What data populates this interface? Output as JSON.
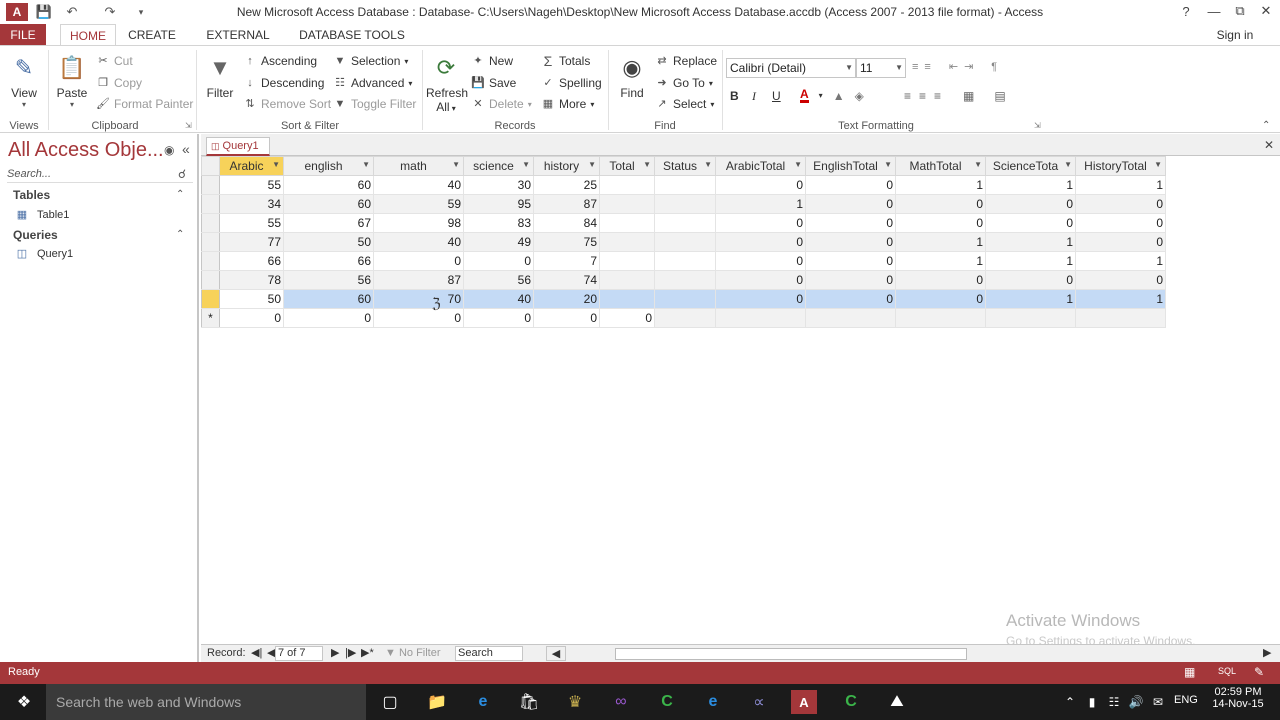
{
  "window": {
    "title": "New Microsoft Access Database : Database- C:\\Users\\Nageh\\Desktop\\New Microsoft Access Database.accdb (Access 2007 - 2013 file format) - Access",
    "help": "?",
    "sign_in": "Sign in"
  },
  "tabs": [
    "FILE",
    "HOME",
    "CREATE",
    "EXTERNAL DATA",
    "DATABASE TOOLS"
  ],
  "ribbon": {
    "views": {
      "view": "View",
      "group": "Views"
    },
    "clipboard": {
      "paste": "Paste",
      "cut": "Cut",
      "copy": "Copy",
      "format_painter": "Format Painter",
      "group": "Clipboard"
    },
    "sort_filter": {
      "filter": "Filter",
      "ascending": "Ascending",
      "descending": "Descending",
      "remove_sort": "Remove Sort",
      "selection": "Selection",
      "advanced": "Advanced",
      "toggle_filter": "Toggle Filter",
      "group": "Sort & Filter"
    },
    "records": {
      "refresh": "Refresh",
      "refresh_all": "All",
      "new": "New",
      "save": "Save",
      "delete": "Delete",
      "totals": "Totals",
      "spelling": "Spelling",
      "more": "More",
      "group": "Records"
    },
    "find": {
      "find": "Find",
      "replace": "Replace",
      "goto": "Go To",
      "select": "Select",
      "group": "Find"
    },
    "text_formatting": {
      "font": "Calibri (Detail)",
      "size": "11",
      "bold": "B",
      "italic": "I",
      "underline": "U",
      "group": "Text Formatting"
    }
  },
  "nav": {
    "header": "All Access Obje...",
    "search_placeholder": "Search...",
    "sections": [
      {
        "title": "Tables",
        "items": [
          "Table1"
        ]
      },
      {
        "title": "Queries",
        "items": [
          "Query1"
        ]
      }
    ]
  },
  "doc_tab": "Query1",
  "grid": {
    "columns": [
      "Arabic",
      "english",
      "math",
      "science",
      "history",
      "Total",
      "Status",
      "ArabicTotal",
      "EnglishTotal",
      "MathTotal",
      "ScienceTota",
      "HistoryTotal"
    ],
    "rows": [
      [
        "55",
        "60",
        "40",
        "30",
        "25",
        "",
        "",
        "0",
        "0",
        "1",
        "1",
        "1"
      ],
      [
        "34",
        "60",
        "59",
        "95",
        "87",
        "",
        "",
        "1",
        "0",
        "0",
        "0",
        "0"
      ],
      [
        "55",
        "67",
        "98",
        "83",
        "84",
        "",
        "",
        "0",
        "0",
        "0",
        "0",
        "0"
      ],
      [
        "77",
        "50",
        "40",
        "49",
        "75",
        "",
        "",
        "0",
        "0",
        "1",
        "1",
        "0"
      ],
      [
        "66",
        "66",
        "0",
        "0",
        "7",
        "",
        "",
        "0",
        "0",
        "1",
        "1",
        "1"
      ],
      [
        "78",
        "56",
        "87",
        "56",
        "74",
        "",
        "",
        "0",
        "0",
        "0",
        "0",
        "0"
      ],
      [
        "50",
        "60",
        "70",
        "40",
        "20",
        "",
        "",
        "0",
        "0",
        "0",
        "1",
        "1"
      ]
    ],
    "new_row": [
      "0",
      "0",
      "0",
      "0",
      "0",
      "0",
      "",
      "",
      "",
      "",
      "",
      ""
    ],
    "new_marker": "*"
  },
  "record_nav": {
    "label": "Record:",
    "position": "7 of 7",
    "filter": "No Filter",
    "search": "Search"
  },
  "status": {
    "text": "Ready",
    "sql": "SQL"
  },
  "watermark": {
    "line1": "Activate Windows",
    "line2": "Go to Settings to activate Windows."
  },
  "taskbar": {
    "search": "Search the web and Windows",
    "lang": "ENG",
    "time": "02:59 PM",
    "date": "14-Nov-15"
  }
}
